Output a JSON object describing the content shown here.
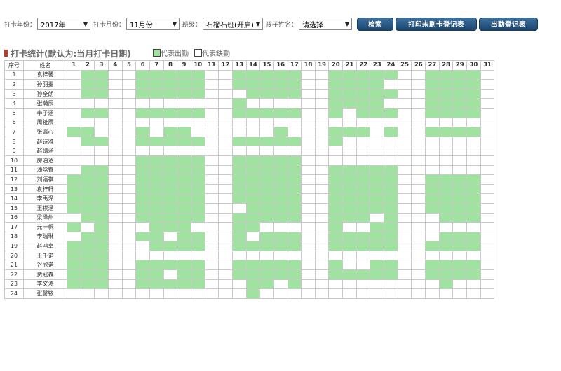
{
  "filters": {
    "year_label": "打卡年份：",
    "year_value": "2017年",
    "month_label": "打卡月份：",
    "month_value": "11月份",
    "class_label": "班级：",
    "class_value": "石榴石班(开启)",
    "child_label": "孩子姓名：",
    "child_value": "请选择"
  },
  "buttons": {
    "search": "检索",
    "print_unswiped": "打印未刷卡登记表",
    "attendance_register": "出勤登记表"
  },
  "section": {
    "title": "打卡统计(默认为:当月打卡日期)",
    "legend_present": "代表出勤",
    "legend_absent": "代表缺勤"
  },
  "colors": {
    "present": "#a0e3a0",
    "absent": "#ffffff",
    "button": "#1f4a75"
  },
  "table": {
    "header_index": "序号",
    "header_name": "姓名",
    "days": [
      "1",
      "2",
      "3",
      "4",
      "5",
      "6",
      "7",
      "8",
      "9",
      "10",
      "11",
      "12",
      "13",
      "14",
      "15",
      "16",
      "17",
      "18",
      "19",
      "20",
      "21",
      "22",
      "23",
      "24",
      "25",
      "26",
      "27",
      "28",
      "29",
      "30",
      "31"
    ],
    "rows": [
      {
        "no": "1",
        "name": "袁梓馨",
        "att": "0110011111001111100111110011110"
      },
      {
        "no": "2",
        "name": "孙羽墨",
        "att": "0110011111001111100111100011110"
      },
      {
        "no": "3",
        "name": "孙全朗",
        "att": "0110011111000111100111110011110"
      },
      {
        "no": "4",
        "name": "张瀚辰",
        "att": "0000000000001000000111100011110"
      },
      {
        "no": "5",
        "name": "李子涵",
        "att": "0110011111001111100101110011110"
      },
      {
        "no": "6",
        "name": "周祉辰",
        "att": "0000000000000000000000000000000"
      },
      {
        "no": "7",
        "name": "张瀛心",
        "att": "1100010110000001000111010011110"
      },
      {
        "no": "8",
        "name": "赵诗雅",
        "att": "0110011111001111100100000000000"
      },
      {
        "no": "9",
        "name": "赵靖涵",
        "att": "0000000000000000000000000000000"
      },
      {
        "no": "10",
        "name": "房泊达",
        "att": "0000011111001111100000000000000"
      },
      {
        "no": "11",
        "name": "潘晗睿",
        "att": "0110011111001111100111110000000"
      },
      {
        "no": "12",
        "name": "刘语祺",
        "att": "1110011111001111100111110011110"
      },
      {
        "no": "13",
        "name": "袁梓轩",
        "att": "1110011111001111100111110011110"
      },
      {
        "no": "14",
        "name": "李禹泽",
        "att": "1110011111001111100111110011110"
      },
      {
        "no": "15",
        "name": "王祺涵",
        "att": "1110011111000111100111110011110"
      },
      {
        "no": "16",
        "name": "梁泽州",
        "att": "0110011111001111100111010001110"
      },
      {
        "no": "17",
        "name": "元一帆",
        "att": "1010001110001100000100110000000"
      },
      {
        "no": "18",
        "name": "李瑞琳",
        "att": "0110011011001011100111110001110"
      },
      {
        "no": "19",
        "name": "赵鸿卓",
        "att": "1110001111001111100111110011110"
      },
      {
        "no": "20",
        "name": "王千诺",
        "att": "1110000000000000000000000000000"
      },
      {
        "no": "21",
        "name": "谷欣诺",
        "att": "1110011111001111100100110011110"
      },
      {
        "no": "22",
        "name": "黄冠森",
        "att": "1110011011001111100111110011110"
      },
      {
        "no": "23",
        "name": "李文涛",
        "att": "1110011111000110100000000001000"
      },
      {
        "no": "24",
        "name": "张馨铱",
        "att": "0000000000000100000000000000000"
      }
    ]
  }
}
